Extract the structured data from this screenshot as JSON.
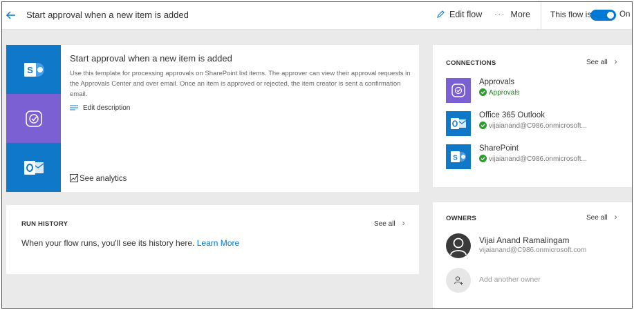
{
  "header": {
    "title": "Start approval when a new item is added",
    "edit_flow_label": "Edit flow",
    "more_label": "More",
    "flow_state_label": "This flow is",
    "toggle_label": "On",
    "toggle_on": true
  },
  "summary": {
    "title": "Start approval when a new item is added",
    "description": "Use this template for processing approvals on SharePoint list items. The approver can view their approval requests in the Approvals Center and over email. Once an item is approved or rejected, the item creator is sent a confirmation email.",
    "edit_description_label": "Edit description",
    "analytics_label": "See analytics",
    "icons": [
      {
        "name": "sharepoint-icon",
        "color": "#0f78c9"
      },
      {
        "name": "approvals-icon",
        "color": "#7a60d2"
      },
      {
        "name": "outlook-icon",
        "color": "#0f78c9"
      }
    ]
  },
  "run_history": {
    "heading": "RUN HISTORY",
    "see_all_label": "See all",
    "message": "When your flow runs, you'll see its history here.",
    "learn_more_label": "Learn More"
  },
  "connections": {
    "heading": "CONNECTIONS",
    "see_all_label": "See all",
    "items": [
      {
        "name": "Approvals",
        "subtitle": "Approvals",
        "icon": "approvals-icon",
        "color": "#7a60d2"
      },
      {
        "name": "Office 365 Outlook",
        "subtitle": "vijaianand@C986.onmicrosoft...",
        "icon": "outlook-icon",
        "color": "#0f78c9"
      },
      {
        "name": "SharePoint",
        "subtitle": "vijaianand@C986.onmicrosoft...",
        "icon": "sharepoint-icon",
        "color": "#0f78c9"
      }
    ]
  },
  "owners": {
    "heading": "OWNERS",
    "see_all_label": "See all",
    "owner_name": "Vijai Anand Ramalingam",
    "owner_email": "vijaianand@C986.onmicrosoft.com",
    "add_owner_label": "Add another owner"
  },
  "colors": {
    "accent": "#0078d4",
    "approvals_purple": "#7a60d2",
    "office_blue": "#0f78c9",
    "check_green": "#2d9e2d"
  }
}
